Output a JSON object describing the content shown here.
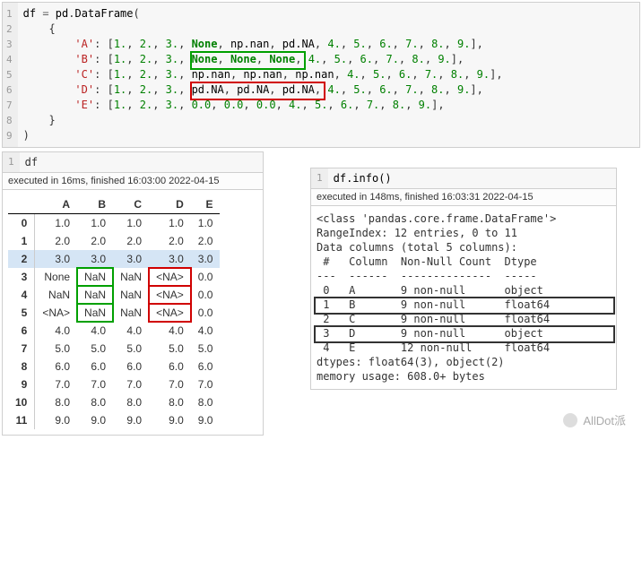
{
  "code_cell": {
    "lines": [
      {
        "n": "1",
        "prefix": "",
        "var": "df",
        "sp": " ",
        "eq": "=",
        "sp2": " ",
        "mod": "pd",
        "dot": ".",
        "fn": "DataFrame",
        "open": "("
      },
      {
        "n": "2",
        "raw": "    {"
      },
      {
        "n": "3",
        "key": "'A'",
        "vals": [
          "1.",
          "2.",
          "3.",
          "None",
          "np.nan",
          "pd.NA",
          "4.",
          "5.",
          "6.",
          "7.",
          "8.",
          "9."
        ]
      },
      {
        "n": "4",
        "key": "'B'",
        "vals": [
          "1.",
          "2.",
          "3.",
          "None",
          "None",
          "None",
          "4.",
          "5.",
          "6.",
          "7.",
          "8.",
          "9."
        ]
      },
      {
        "n": "5",
        "key": "'C'",
        "vals": [
          "1.",
          "2.",
          "3.",
          "np.nan",
          "np.nan",
          "np.nan",
          "4.",
          "5.",
          "6.",
          "7.",
          "8.",
          "9."
        ]
      },
      {
        "n": "6",
        "key": "'D'",
        "vals": [
          "1.",
          "2.",
          "3.",
          "pd.NA",
          "pd.NA",
          "pd.NA",
          "4.",
          "5.",
          "6.",
          "7.",
          "8.",
          "9."
        ]
      },
      {
        "n": "7",
        "key": "'E'",
        "vals": [
          "1.",
          "2.",
          "3.",
          "0.0",
          "0.0",
          "0.0",
          "4.",
          "5.",
          "6.",
          "7.",
          "8.",
          "9."
        ]
      },
      {
        "n": "8",
        "raw": "    }"
      },
      {
        "n": "9",
        "raw": ")"
      }
    ]
  },
  "left": {
    "code": "df",
    "exec": "executed in 16ms, finished 16:03:00 2022-04-15",
    "columns": [
      "",
      "A",
      "B",
      "C",
      "D",
      "E"
    ],
    "rows": [
      {
        "idx": "0",
        "cells": [
          "1.0",
          "1.0",
          "1.0",
          "1.0",
          "1.0"
        ]
      },
      {
        "idx": "1",
        "cells": [
          "2.0",
          "2.0",
          "2.0",
          "2.0",
          "2.0"
        ]
      },
      {
        "idx": "2",
        "cells": [
          "3.0",
          "3.0",
          "3.0",
          "3.0",
          "3.0"
        ],
        "hl": true
      },
      {
        "idx": "3",
        "cells": [
          "None",
          "NaN",
          "NaN",
          "<NA>",
          "0.0"
        ]
      },
      {
        "idx": "4",
        "cells": [
          "NaN",
          "NaN",
          "NaN",
          "<NA>",
          "0.0"
        ]
      },
      {
        "idx": "5",
        "cells": [
          "<NA>",
          "NaN",
          "NaN",
          "<NA>",
          "0.0"
        ]
      },
      {
        "idx": "6",
        "cells": [
          "4.0",
          "4.0",
          "4.0",
          "4.0",
          "4.0"
        ]
      },
      {
        "idx": "7",
        "cells": [
          "5.0",
          "5.0",
          "5.0",
          "5.0",
          "5.0"
        ]
      },
      {
        "idx": "8",
        "cells": [
          "6.0",
          "6.0",
          "6.0",
          "6.0",
          "6.0"
        ]
      },
      {
        "idx": "9",
        "cells": [
          "7.0",
          "7.0",
          "7.0",
          "7.0",
          "7.0"
        ]
      },
      {
        "idx": "10",
        "cells": [
          "8.0",
          "8.0",
          "8.0",
          "8.0",
          "8.0"
        ]
      },
      {
        "idx": "11",
        "cells": [
          "9.0",
          "9.0",
          "9.0",
          "9.0",
          "9.0"
        ]
      }
    ],
    "hl_col_green": "B",
    "hl_col_red": "D",
    "hl_row_start": 3,
    "hl_row_end": 5
  },
  "right": {
    "code": "df.info()",
    "exec": "executed in 148ms, finished 16:03:31 2022-04-15",
    "info_lines": [
      "<class 'pandas.core.frame.DataFrame'>",
      "RangeIndex: 12 entries, 0 to 11",
      "Data columns (total 5 columns):",
      " #   Column  Non-Null Count  Dtype  ",
      "---  ------  --------------  -----  ",
      " 0   A       9 non-null      object ",
      " 1   B       9 non-null      float64",
      " 2   C       9 non-null      float64",
      " 3   D       9 non-null      object ",
      " 4   E       12 non-null     float64",
      "dtypes: float64(3), object(2)",
      "memory usage: 608.0+ bytes"
    ],
    "hl_green_line": 6,
    "hl_red_line": 8
  },
  "watermark": "AllDot派"
}
